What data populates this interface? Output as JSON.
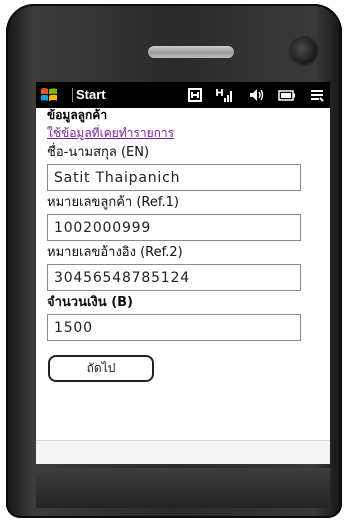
{
  "status_bar": {
    "start_label": "Start",
    "icons": [
      "windows-flag-icon",
      "network-h-icon",
      "signal-icon",
      "volume-icon",
      "battery-icon",
      "menu-icon"
    ]
  },
  "form": {
    "section_title": "ข้อมูลลูกค้า",
    "history_link": "ใช้ข้อมูลที่เคยทำรายการ",
    "fields": [
      {
        "label": "ชื่อ-นามสกุล (EN)",
        "value": "Satit Thaipanich"
      },
      {
        "label": "หมายเลขลูกค้า (Ref.1)",
        "value": "1002000999"
      },
      {
        "label": "หมายเลขอ้างอิง (Ref.2)",
        "value": "30456548785124"
      },
      {
        "label": "จำนวนเงิน (B)",
        "value": "1500"
      }
    ],
    "next_button": "ถัดไป"
  },
  "colors": {
    "status_bar_bg": "#000000",
    "link": "#7a1fa0",
    "device_body": "#2a2a2a"
  }
}
